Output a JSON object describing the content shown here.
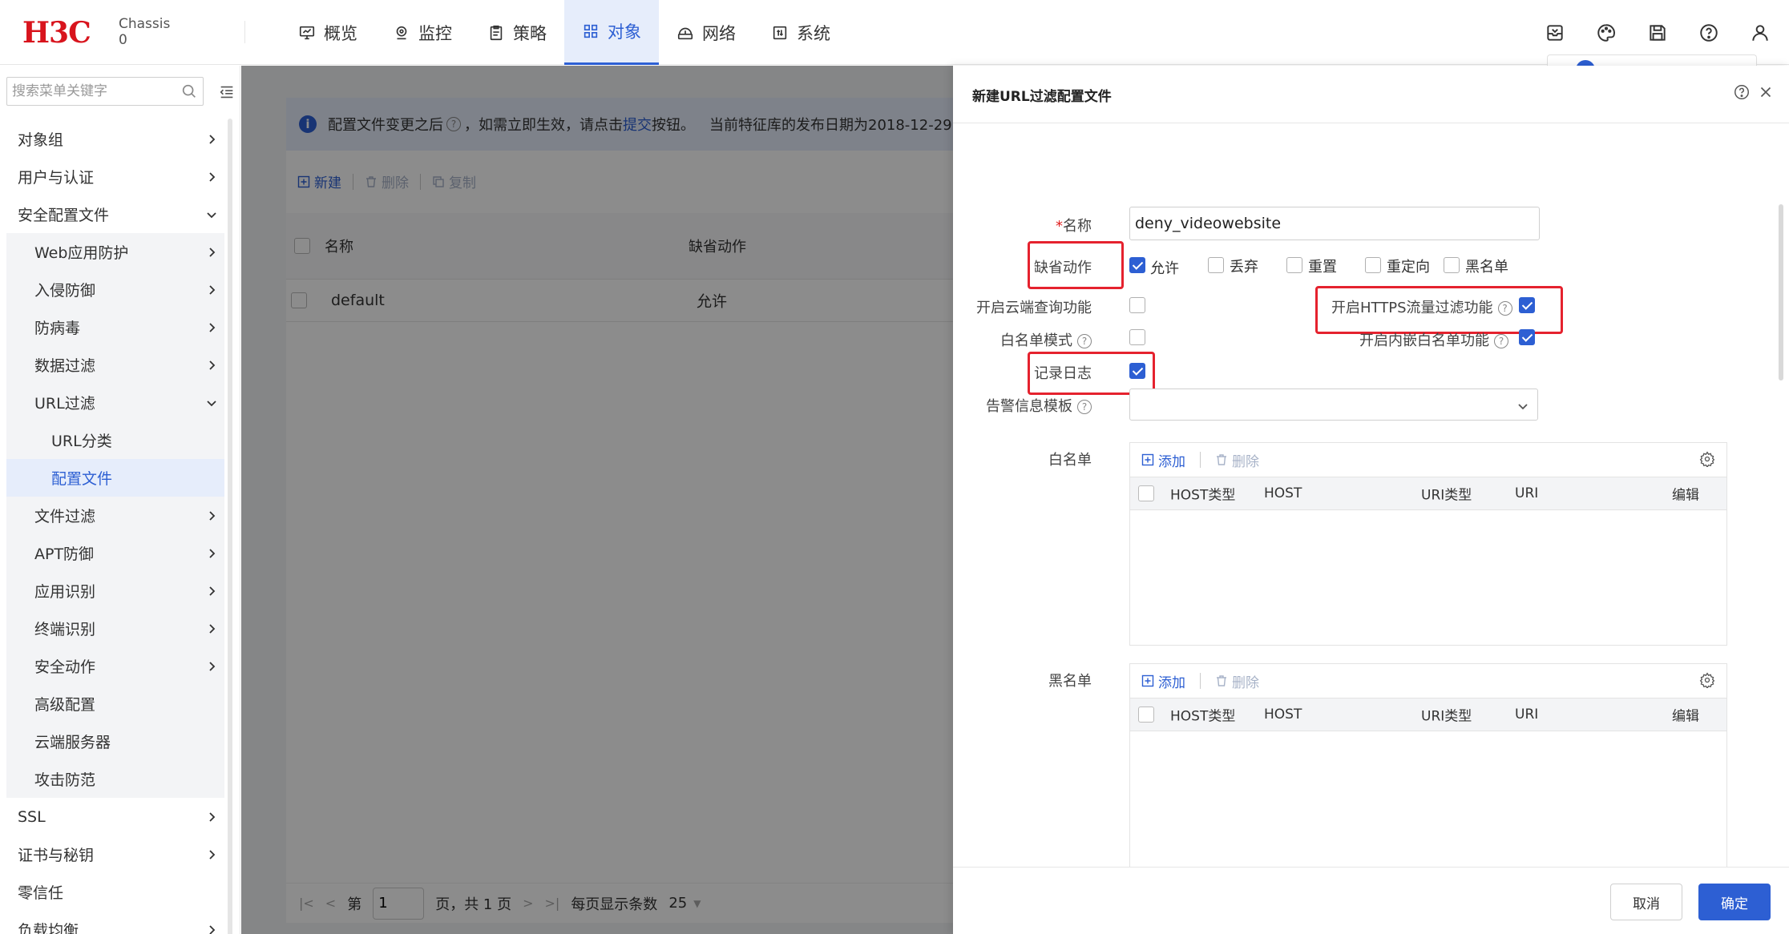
{
  "brand": {
    "logo": "H3C",
    "chassis_label": "Chassis",
    "chassis_value": "0"
  },
  "nav": [
    {
      "label": "概览",
      "icon": "monitor-icon"
    },
    {
      "label": "监控",
      "icon": "location-pin-icon"
    },
    {
      "label": "策略",
      "icon": "clipboard-icon"
    },
    {
      "label": "对象",
      "icon": "grid-icon",
      "active": true
    },
    {
      "label": "网络",
      "icon": "network-icon"
    },
    {
      "label": "系统",
      "icon": "system-icon"
    }
  ],
  "top_icons": [
    "inbox-icon",
    "palette-icon",
    "save-icon",
    "help-icon",
    "user-icon"
  ],
  "sidebar": {
    "search_placeholder": "搜索菜单关键字",
    "items": [
      {
        "label": "对象组",
        "chevron": "right"
      },
      {
        "label": "用户与认证",
        "chevron": "right"
      },
      {
        "label": "安全配置文件",
        "chevron": "down"
      },
      {
        "label": "Web应用防护",
        "chevron": "right"
      },
      {
        "label": "入侵防御",
        "chevron": "right"
      },
      {
        "label": "防病毒",
        "chevron": "right"
      },
      {
        "label": "数据过滤",
        "chevron": "right"
      },
      {
        "label": "URL过滤",
        "chevron": "down"
      },
      {
        "label": "URL分类"
      },
      {
        "label": "配置文件",
        "selected": true
      },
      {
        "label": "文件过滤",
        "chevron": "right"
      },
      {
        "label": "APT防御",
        "chevron": "right"
      },
      {
        "label": "应用识别",
        "chevron": "right"
      },
      {
        "label": "终端识别",
        "chevron": "right"
      },
      {
        "label": "安全动作",
        "chevron": "right"
      },
      {
        "label": "高级配置"
      },
      {
        "label": "云端服务器"
      },
      {
        "label": "攻击防范"
      },
      {
        "label": "SSL",
        "chevron": "right"
      },
      {
        "label": "证书与秘钥",
        "chevron": "right"
      },
      {
        "label": "零信任"
      },
      {
        "label": "负载均衡",
        "chevron": "right"
      }
    ]
  },
  "main": {
    "notice": {
      "part1": "配置文件变更之后",
      "part2": "，如需立即生效，请点击",
      "link": "提交",
      "part3": "按钮。",
      "part4": "当前特征库的发布日期为2018-12-29"
    },
    "toolbar": {
      "new": "新建",
      "delete": "删除",
      "copy": "复制"
    },
    "table": {
      "headers": {
        "name": "名称",
        "default_action": "缺省动作"
      },
      "rows": [
        {
          "name": "default",
          "default_action": "允许"
        }
      ]
    },
    "pager": {
      "page_prefix": "第",
      "page_value": "1",
      "page_suffix": "页，共 1 页",
      "page_size_label": "每页显示条数",
      "page_size": "25"
    }
  },
  "dialog": {
    "title": "新建URL过滤配置文件",
    "name_label": "名称",
    "name_value": "deny_videowebsite",
    "default_action_label": "缺省动作",
    "actions": [
      {
        "label": "允许",
        "checked": true
      },
      {
        "label": "丢弃",
        "checked": false
      },
      {
        "label": "重置",
        "checked": false
      },
      {
        "label": "重定向",
        "checked": false
      },
      {
        "label": "黑名单",
        "checked": false
      }
    ],
    "cloud_query_label": "开启云端查询功能",
    "cloud_query_checked": false,
    "https_filter_label": "开启HTTPS流量过滤功能",
    "https_filter_checked": true,
    "whitelist_mode_label": "白名单模式",
    "whitelist_mode_checked": false,
    "builtin_whitelist_label": "开启内嵌白名单功能",
    "builtin_whitelist_checked": true,
    "log_label": "记录日志",
    "log_checked": true,
    "alarm_template_label": "告警信息模板",
    "alarm_template_value": "",
    "whitelist": {
      "label": "白名单",
      "add": "添加",
      "delete": "删除",
      "headers": [
        "HOST类型",
        "HOST",
        "URI类型",
        "URI",
        "编辑"
      ]
    },
    "blacklist": {
      "label": "黑名单",
      "add": "添加",
      "delete": "删除",
      "headers": [
        "HOST类型",
        "HOST",
        "URI类型",
        "URI",
        "编辑"
      ]
    },
    "cancel_label": "取消",
    "ok_label": "确定"
  },
  "colors": {
    "accent": "#2d5fd3",
    "brand_red": "#d8141d",
    "highlight": "#e5222e"
  }
}
